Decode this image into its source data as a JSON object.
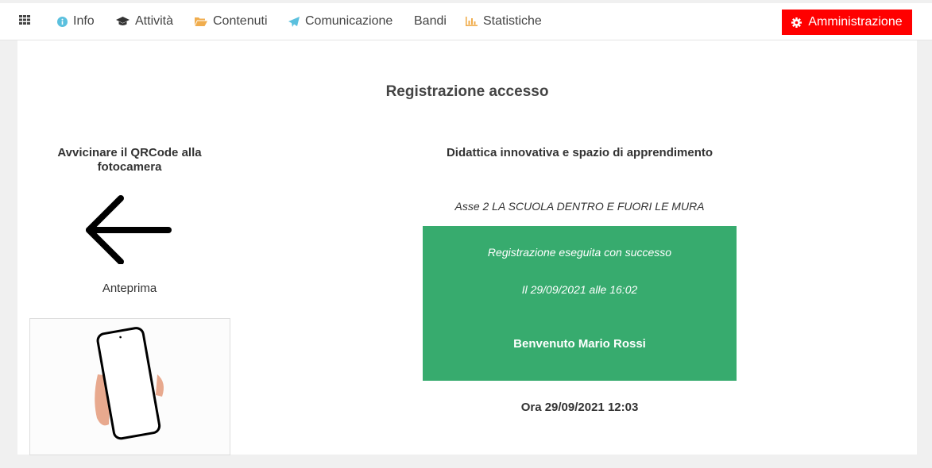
{
  "nav": {
    "items": [
      {
        "label": "Info",
        "icon": "info-circle-icon",
        "color": "#5bc0de"
      },
      {
        "label": "Attività",
        "icon": "graduation-cap-icon",
        "color": "#333333"
      },
      {
        "label": "Contenuti",
        "icon": "folder-open-icon",
        "color": "#f0ad4e"
      },
      {
        "label": "Comunicazione",
        "icon": "paper-plane-icon",
        "color": "#5bc0de"
      },
      {
        "label": "Bandi",
        "icon": "",
        "color": ""
      },
      {
        "label": "Statistiche",
        "icon": "bar-chart-icon",
        "color": "#f0ad4e"
      }
    ],
    "admin_label": "Amministrazione",
    "admin_color": "#ff0000"
  },
  "page": {
    "title": "Registrazione accesso",
    "qr_instruction": "Avvicinare il QRCode alla fotocamera",
    "preview_label": "Anteprima"
  },
  "event": {
    "title": "Didattica innovativa e spazio di apprendimento",
    "subtitle": "Asse 2 LA SCUOLA DENTRO E FUORI LE MURA"
  },
  "result": {
    "status": "Registrazione eseguita con successo",
    "datetime": "Il 29/09/2021 alle 16:02",
    "welcome": "Benvenuto Mario Rossi",
    "color": "#37ab6e"
  },
  "clock": "Ora 29/09/2021 12:03"
}
